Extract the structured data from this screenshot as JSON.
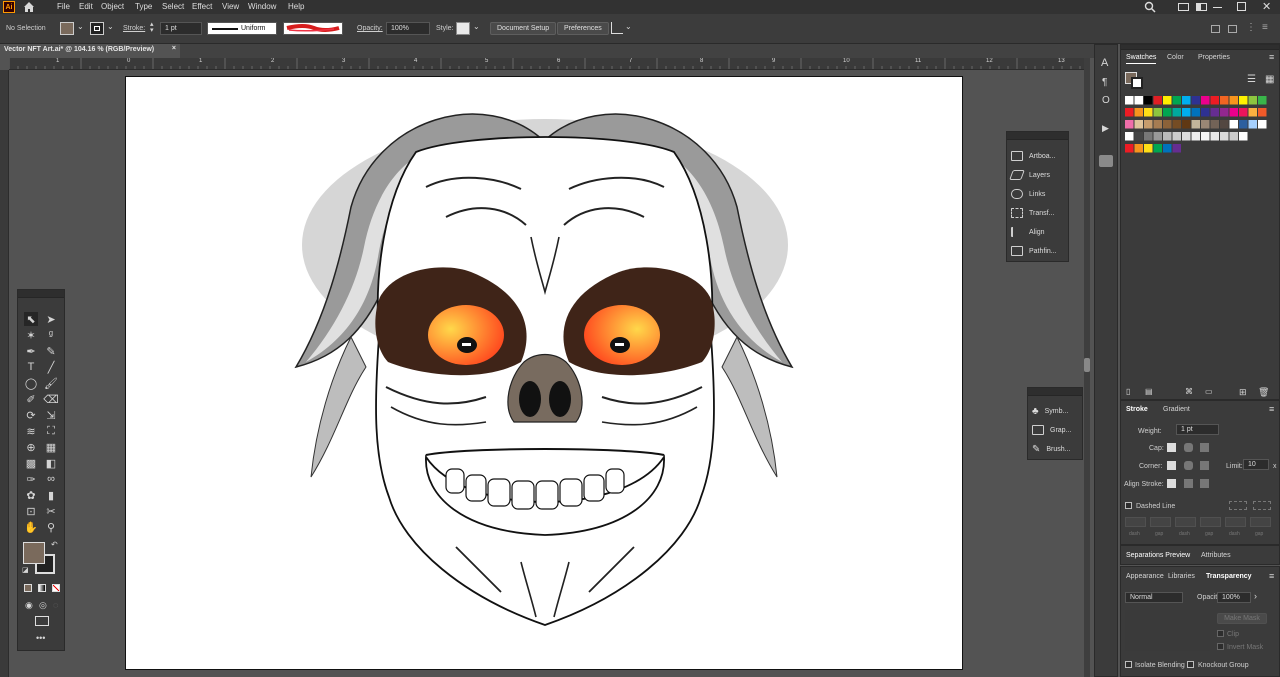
{
  "app": {
    "logo": "Ai",
    "menus": [
      "File",
      "Edit",
      "Object",
      "Type",
      "Select",
      "Effect",
      "View",
      "Window",
      "Help"
    ]
  },
  "control": {
    "selection": "No Selection",
    "stroke_label": "Stroke:",
    "stroke_weight": "1 pt",
    "profile": "Uniform",
    "opacity_label": "Opacity:",
    "opacity": "100%",
    "style_label": "Style:",
    "document_setup": "Document Setup",
    "preferences": "Preferences"
  },
  "tab": {
    "title": "Vector NFT Art.ai* @ 104.16 % (RGB/Preview)",
    "close": "×"
  },
  "ruler": {
    "marks": [
      "1",
      "0",
      "1",
      "2",
      "3",
      "4",
      "5",
      "6",
      "7",
      "8",
      "9",
      "10",
      "11",
      "12",
      "13"
    ]
  },
  "dock1": {
    "items": [
      "Artboa...",
      "Layers",
      "Links",
      "Transf...",
      "Align",
      "Pathfin..."
    ]
  },
  "dock2": {
    "items": [
      "Symb...",
      "Grap...",
      "Brush..."
    ]
  },
  "swatches": {
    "tabs": [
      "Swatches",
      "Color",
      "Properties"
    ]
  },
  "stroke_panel": {
    "tabs": [
      "Stroke",
      "Gradient"
    ],
    "weight_label": "Weight:",
    "weight": "1 pt",
    "cap_label": "Cap:",
    "corner_label": "Corner:",
    "limit_label": "Limit:",
    "limit": "10",
    "limit_unit": "x",
    "align_label": "Align Stroke:",
    "dashed_label": "Dashed Line",
    "dash_labels": [
      "dash",
      "gap",
      "dash",
      "gap",
      "dash",
      "gap"
    ]
  },
  "sep_panel": {
    "tabs": [
      "Separations Preview",
      "Attributes"
    ]
  },
  "transparency": {
    "tabs": [
      "Appearance",
      "Libraries",
      "Transparency"
    ],
    "blend": "Normal",
    "opacity_label": "Opacity:",
    "opacity": "100%",
    "make_mask": "Make Mask",
    "clip": "Clip",
    "invert": "Invert Mask",
    "isolate": "Isolate Blending",
    "knockout": "Knockout Group"
  },
  "colors": {
    "ui_bg": "#535353",
    "panel": "#3b3b3b",
    "accent_orange": "#ff9a00",
    "brown": "#3f2418",
    "fill_swatch": "#7a6a5c"
  }
}
